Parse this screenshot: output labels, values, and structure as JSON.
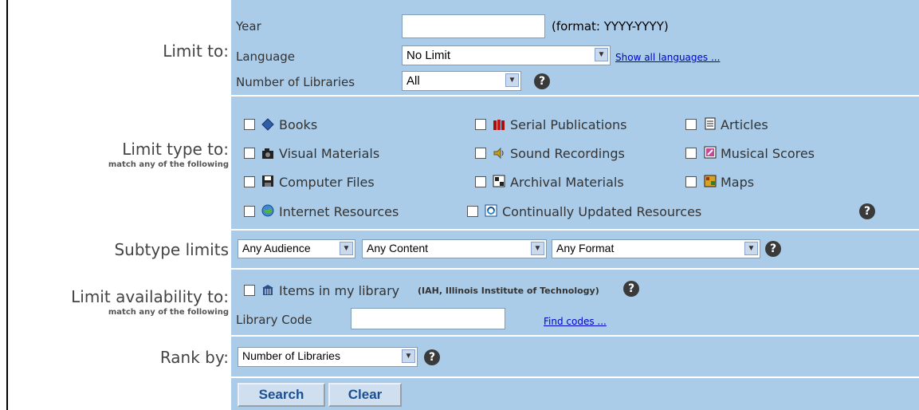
{
  "limit_to": {
    "label": "Limit to:",
    "year_label": "Year",
    "year_value": "",
    "year_hint": "(format: YYYY-YYYY)",
    "language_label": "Language",
    "language_value": "No Limit",
    "show_languages_link": "Show all languages ...",
    "libraries_label": "Number of Libraries",
    "libraries_value": "All"
  },
  "limit_type": {
    "label": "Limit type to:",
    "sublabel": "match any of the following",
    "items": [
      {
        "label": "Books",
        "icon": "book-icon"
      },
      {
        "label": "Serial Publications",
        "icon": "serial-icon"
      },
      {
        "label": "Articles",
        "icon": "article-icon"
      },
      {
        "label": "Visual Materials",
        "icon": "camera-icon"
      },
      {
        "label": "Sound Recordings",
        "icon": "speaker-icon"
      },
      {
        "label": "Musical Scores",
        "icon": "score-icon"
      },
      {
        "label": "Computer Files",
        "icon": "floppy-icon"
      },
      {
        "label": "Archival Materials",
        "icon": "archive-icon"
      },
      {
        "label": "Maps",
        "icon": "map-icon"
      },
      {
        "label": "Internet Resources",
        "icon": "globe-icon"
      },
      {
        "label": "Continually Updated Resources",
        "icon": "update-icon"
      }
    ]
  },
  "subtype": {
    "label": "Subtype limits",
    "audience": "Any Audience",
    "content": "Any Content",
    "format": "Any Format"
  },
  "availability": {
    "label": "Limit availability to:",
    "sublabel": "match any of the following",
    "items_label": "Items in my library",
    "items_note": "(IAH, Illinois Institute of Technology)",
    "code_label": "Library Code",
    "code_value": "",
    "find_codes_link": "Find codes ..."
  },
  "rank": {
    "label": "Rank by:",
    "value": "Number of Libraries"
  },
  "buttons": {
    "search": "Search",
    "clear": "Clear"
  },
  "colors": {
    "panel": "#aacce8",
    "label_text": "#444444",
    "link": "#0000cc"
  }
}
